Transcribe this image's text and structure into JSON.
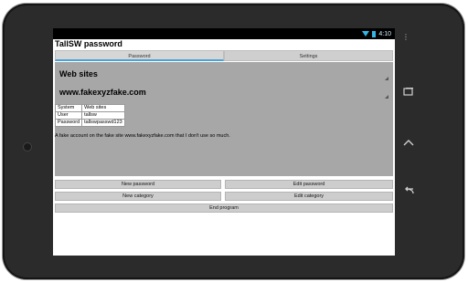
{
  "status": {
    "time": "4:10"
  },
  "app": {
    "title": "TallSW password"
  },
  "tabs": [
    {
      "label": "Password",
      "active": true
    },
    {
      "label": "Settings",
      "active": false
    }
  ],
  "selection": {
    "category": "Web sites",
    "entry": "www.fakexyzfake.com"
  },
  "details": {
    "rows": [
      {
        "key": "System",
        "value": "Web sites"
      },
      {
        "key": "User",
        "value": "tallsw"
      },
      {
        "key": "Password",
        "value": "tallswpasswd123"
      }
    ],
    "description": "A fake account on the fake site www.fakexyzfake.com that I don't use so much."
  },
  "buttons": {
    "new_password": "New password",
    "edit_password": "Edit password",
    "new_category": "New category",
    "edit_category": "Edit category",
    "end_program": "End program"
  },
  "colors": {
    "accent": "#4aa3d8",
    "panel": "#a7a7a7"
  },
  "icons": {
    "wifi": "wifi-icon",
    "battery": "battery-icon",
    "menu": "overflow-menu-icon",
    "recent": "recent-apps-icon",
    "home": "home-icon",
    "back": "back-icon"
  }
}
